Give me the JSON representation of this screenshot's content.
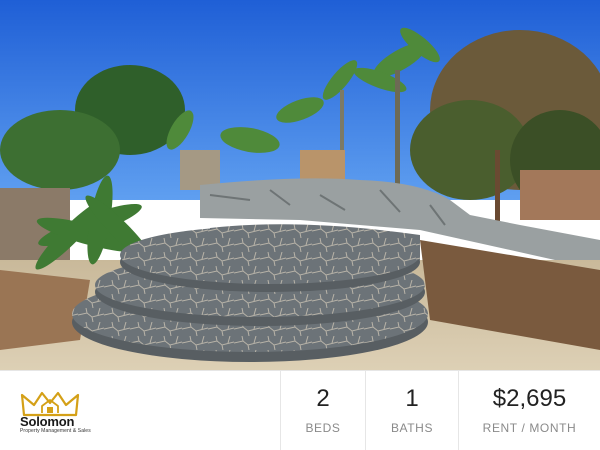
{
  "listing": {
    "beds_value": "2",
    "beds_label": "BEDS",
    "baths_value": "1",
    "baths_label": "BATHS",
    "rent_value": "$2,695",
    "rent_label": "RENT / MONTH"
  },
  "brand": {
    "name": "Solomon",
    "tagline": "Property Management & Sales",
    "logo_icon": "crown-house-icon",
    "accent_color": "#d4a017"
  },
  "photo": {
    "description_icon": "backyard-photo"
  }
}
